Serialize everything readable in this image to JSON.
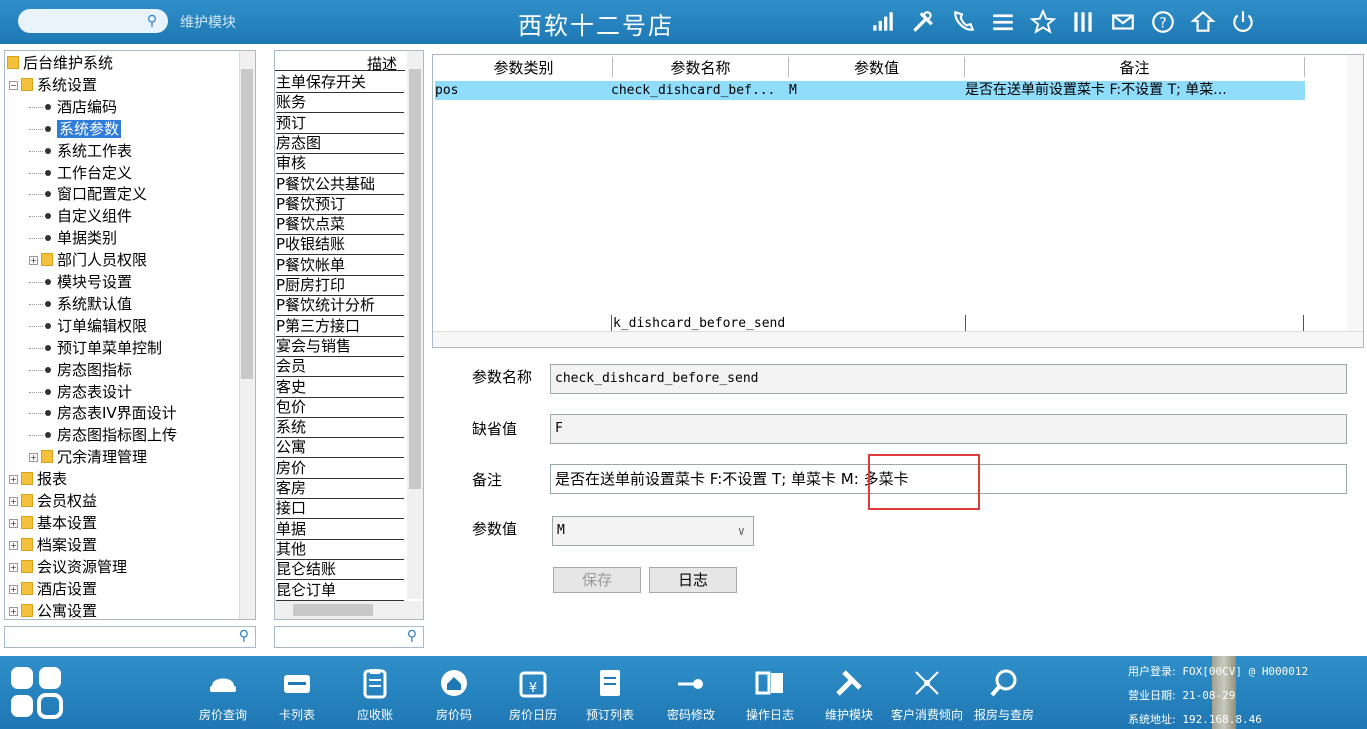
{
  "topbar": {
    "search_placeholder": "",
    "module_label": "维护模块",
    "store_title": "西软十二号店",
    "icons": [
      "signal-icon",
      "tools-icon",
      "phone-icon",
      "menu-icon",
      "star-icon",
      "columns-icon",
      "mail-icon",
      "help-icon",
      "lock-icon",
      "power-icon"
    ]
  },
  "tree": {
    "items": [
      {
        "label": "后台维护系统",
        "type": "folder",
        "level": 0
      },
      {
        "label": "系统设置",
        "type": "folder",
        "level": 1,
        "expanded": true
      },
      {
        "label": "酒店编码",
        "type": "leaf",
        "level": 2
      },
      {
        "label": "系统参数",
        "type": "leaf",
        "level": 2,
        "selected": true
      },
      {
        "label": "系统工作表",
        "type": "leaf",
        "level": 2
      },
      {
        "label": "工作台定义",
        "type": "leaf",
        "level": 2
      },
      {
        "label": "窗口配置定义",
        "type": "leaf",
        "level": 2
      },
      {
        "label": "自定义组件",
        "type": "leaf",
        "level": 2
      },
      {
        "label": "单据类别",
        "type": "leaf",
        "level": 2
      },
      {
        "label": "部门人员权限",
        "type": "folder",
        "level": 2
      },
      {
        "label": "模块号设置",
        "type": "leaf",
        "level": 2
      },
      {
        "label": "系统默认值",
        "type": "leaf",
        "level": 2
      },
      {
        "label": "订单编辑权限",
        "type": "leaf",
        "level": 2
      },
      {
        "label": "预订单菜单控制",
        "type": "leaf",
        "level": 2
      },
      {
        "label": "房态图指标",
        "type": "leaf",
        "level": 2
      },
      {
        "label": "房态表设计",
        "type": "leaf",
        "level": 2
      },
      {
        "label": "房态表IV界面设计",
        "type": "leaf",
        "level": 2
      },
      {
        "label": "房态图指标图上传",
        "type": "leaf",
        "level": 2
      },
      {
        "label": "冗余清理管理",
        "type": "folder",
        "level": 2
      },
      {
        "label": "报表",
        "type": "folder",
        "level": 1
      },
      {
        "label": "会员权益",
        "type": "folder",
        "level": 1
      },
      {
        "label": "基本设置",
        "type": "folder",
        "level": 1
      },
      {
        "label": "档案设置",
        "type": "folder",
        "level": 1
      },
      {
        "label": "会议资源管理",
        "type": "folder",
        "level": 1
      },
      {
        "label": "酒店设置",
        "type": "folder",
        "level": 1
      },
      {
        "label": "公寓设置",
        "type": "folder",
        "level": 1
      }
    ],
    "search_value": ""
  },
  "catlist": {
    "header": "描述",
    "items": [
      "主单保存开关",
      "账务",
      "预订",
      "房态图",
      "审核",
      "P餐饮公共基础",
      "P餐饮预订",
      "P餐饮点菜",
      "P收银结账",
      "P餐饮帐单",
      "P厨房打印",
      "P餐饮统计分析",
      "P第三方接口",
      "宴会与销售",
      "会员",
      "客史",
      "包价",
      "系统",
      "公寓",
      "房价",
      "客房",
      "接口",
      "单据",
      "其他",
      "昆仑结账",
      "昆仑订单"
    ],
    "search_value": ""
  },
  "grid": {
    "headers": [
      "参数类别",
      "参数名称",
      "参数值",
      "备注"
    ],
    "rows": [
      {
        "category": "pos",
        "name": "check_dishcard_bef...",
        "value": "M",
        "remark": "是否在送单前设置菜卡 F:不设置 T; 单菜..."
      }
    ],
    "edit_cell": "k_dishcard_before_send"
  },
  "form": {
    "param_name_label": "参数名称",
    "param_name_value": "check_dishcard_before_send",
    "default_label": "缺省值",
    "default_value": "F",
    "remark_label": "备注",
    "remark_value": "是否在送单前设置菜卡 F:不设置 T; 单菜卡 M: 多菜卡",
    "param_value_label": "参数值",
    "param_value_value": "M",
    "save_button": "保存",
    "log_button": "日志"
  },
  "bottombar": {
    "buttons": [
      {
        "label": "房价查询",
        "icon": "room-rate-icon"
      },
      {
        "label": "卡列表",
        "icon": "card-icon"
      },
      {
        "label": "应收账",
        "icon": "clipboard-icon"
      },
      {
        "label": "房价码",
        "icon": "home-icon"
      },
      {
        "label": "房价日历",
        "icon": "calendar-icon"
      },
      {
        "label": "预订列表",
        "icon": "list-icon"
      },
      {
        "label": "密码修改",
        "icon": "key-icon"
      },
      {
        "label": "操作日志",
        "icon": "book-icon"
      },
      {
        "label": "维护模块",
        "icon": "tools-icon"
      },
      {
        "label": "客户消费倾向",
        "icon": "network-icon"
      },
      {
        "label": "报房与查房",
        "icon": "search-icon"
      }
    ],
    "user_login_label": "用户登录:",
    "user_login_value": "FOX[00CV] @ H000012",
    "business_date_label": "营业日期:",
    "business_date_value": "21-08-29",
    "system_address_label": "系统地址:",
    "system_address_value": "192.168.8.46"
  },
  "colors": {
    "topbar": "#2f8fc9",
    "selected_row": "#8fdcfb",
    "tree_selected": "#2f7bd9",
    "highlight": "#e03a3a"
  }
}
